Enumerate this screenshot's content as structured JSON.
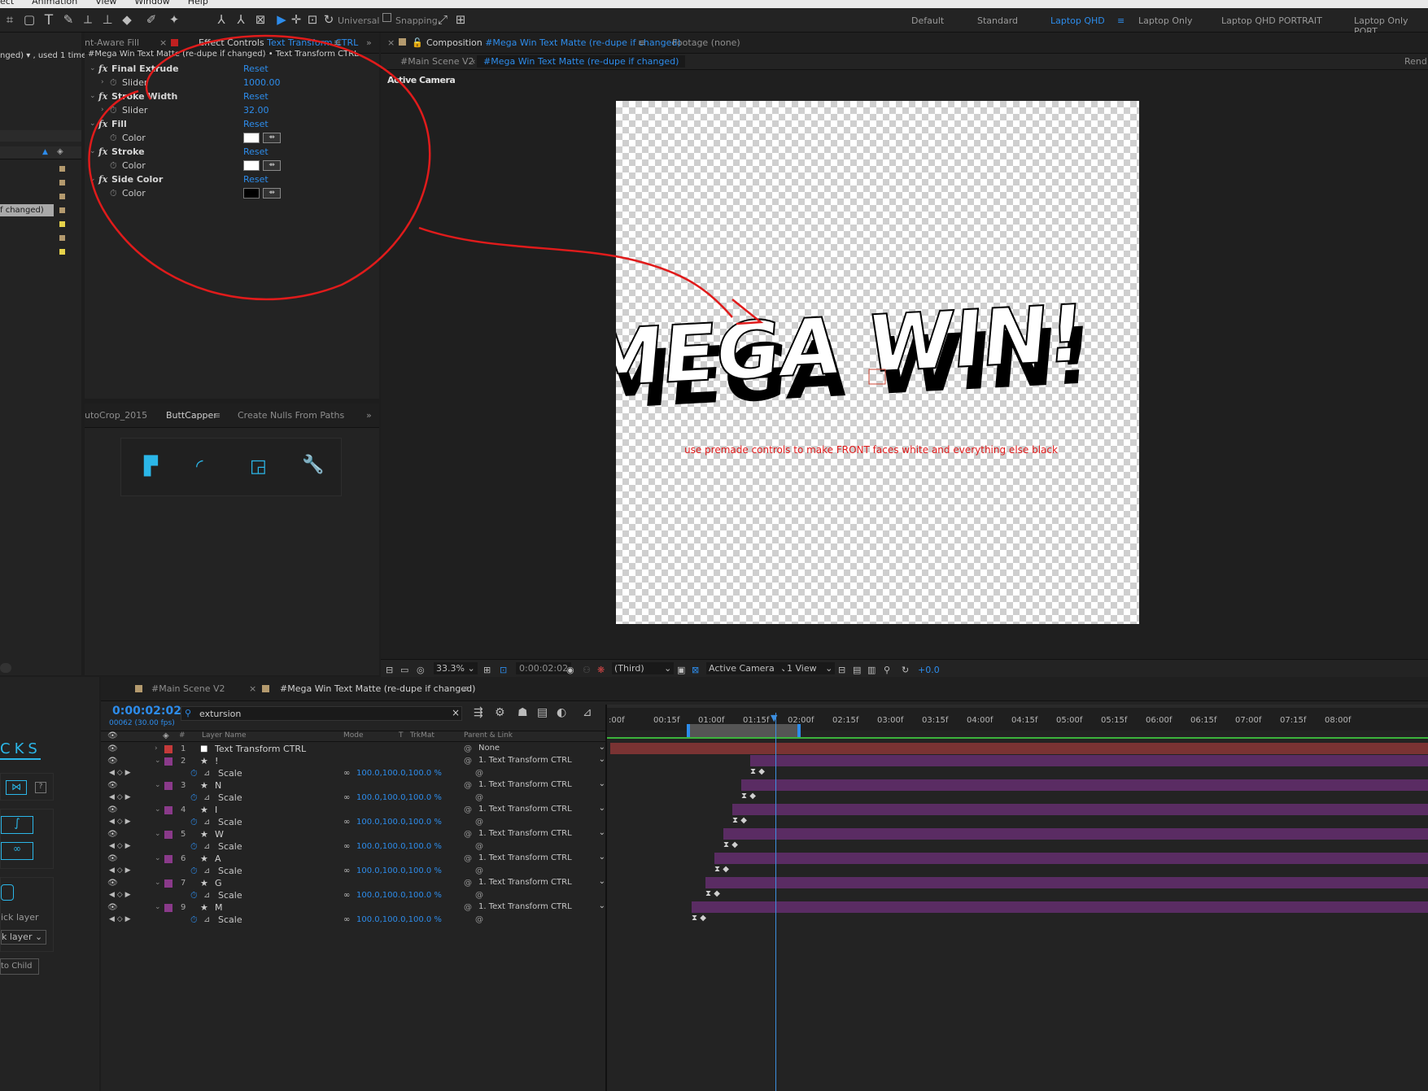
{
  "menu": {
    "items": [
      "ect",
      "Animation",
      "View",
      "Window",
      "Help"
    ]
  },
  "toolbar": {
    "universal_label": "Universal",
    "snapping_label": "Snapping"
  },
  "workspaces": [
    {
      "label": "Default",
      "active": false
    },
    {
      "label": "Standard",
      "active": false
    },
    {
      "label": "Laptop QHD",
      "active": true
    },
    {
      "label": "Laptop Only",
      "active": false
    },
    {
      "label": "Laptop QHD PORTRAIT",
      "active": false
    },
    {
      "label": "Laptop Only PORT",
      "active": false
    }
  ],
  "project": {
    "used_label": "nged) ▾ , used 1 time",
    "selected_item": "f changed)"
  },
  "effect_controls": {
    "tab_prev": "nt-Aware Fill",
    "tab_label": "Effect Controls",
    "tab_target": "Text Transform CTRL",
    "header": "#Mega Win Text Matte (re-dupe if changed) • Text Transform CTRL",
    "rows": [
      {
        "name": "Final Extrude",
        "kind": "effect",
        "value": "Reset"
      },
      {
        "name": "Slider",
        "kind": "prop",
        "value": "1000.00"
      },
      {
        "name": "Stroke Width",
        "kind": "effect",
        "value": "Reset"
      },
      {
        "name": "Slider",
        "kind": "prop",
        "value": "32.00"
      },
      {
        "name": "Fill",
        "kind": "effect",
        "value": "Reset"
      },
      {
        "name": "Color",
        "kind": "color",
        "color": "#ffffff"
      },
      {
        "name": "Stroke",
        "kind": "effect",
        "value": "Reset"
      },
      {
        "name": "Color",
        "kind": "color",
        "color": "#ffffff"
      },
      {
        "name": "Side Color",
        "kind": "effect",
        "value": "Reset"
      },
      {
        "name": "Color",
        "kind": "color",
        "color": "#000000"
      }
    ]
  },
  "lower_left": {
    "tabs": [
      "utoCrop_2015",
      "ButtCapper",
      "Create Nulls From Paths"
    ],
    "active_tab": "ButtCapper"
  },
  "composition": {
    "tab_label": "Composition",
    "tab_name": "#Mega Win Text Matte (re-dupe if changed)",
    "footage_label": "Footage",
    "footage_value": "(none)",
    "breadcrumbs": [
      "#Main Scene V2",
      "#Mega Win Text Matte (re-dupe if changed)"
    ],
    "render_label": "Rend",
    "camera_label": "Active Camera",
    "canvas_text": "MEGA WIN!",
    "annotation": "use premade controls to make FRONT faces white and everything else black",
    "footer": {
      "zoom": "33.3%",
      "timecode": "0:00:02:02",
      "resolution": "(Third)",
      "camera": "Active Camera",
      "views": "1 View",
      "exposure": "+0.0"
    }
  },
  "timeline": {
    "tabs": [
      "#Main Scene V2",
      "#Mega Win Text Matte (re-dupe if changed)"
    ],
    "timecode": "0:00:02:02",
    "frames": "00062 (30.00 fps)",
    "search": "extursion",
    "columns": {
      "layer_name": "Layer Name",
      "mode": "Mode",
      "t": "T",
      "trkmat": "TrkMat",
      "parent": "Parent & Link"
    },
    "ruler": [
      ":00f",
      "00:15f",
      "01:00f",
      "01:15f",
      "02:00f",
      "02:15f",
      "03:00f",
      "03:15f",
      "04:00f",
      "04:15f",
      "05:00f",
      "05:15f",
      "06:00f",
      "06:15f",
      "07:00f",
      "07:15f",
      "08:00f"
    ],
    "layers": [
      {
        "num": "1",
        "name": "Text Transform CTRL",
        "parent": "None",
        "scale": null
      },
      {
        "num": "2",
        "name": "!",
        "parent": "1. Text Transform CTRL",
        "scale": "100.0,100.0,100.0 %"
      },
      {
        "num": "3",
        "name": "N",
        "parent": "1. Text Transform CTRL",
        "scale": "100.0,100.0,100.0 %"
      },
      {
        "num": "4",
        "name": "I",
        "parent": "1. Text Transform CTRL",
        "scale": "100.0,100.0,100.0 %"
      },
      {
        "num": "5",
        "name": "W",
        "parent": "1. Text Transform CTRL",
        "scale": "100.0,100.0,100.0 %"
      },
      {
        "num": "6",
        "name": "A",
        "parent": "1. Text Transform CTRL",
        "scale": "100.0,100.0,100.0 %"
      },
      {
        "num": "7",
        "name": "G",
        "parent": "1. Text Transform CTRL",
        "scale": "100.0,100.0,100.0 %"
      },
      {
        "num": "9",
        "name": "M",
        "parent": "1. Text Transform CTRL",
        "scale": "100.0,100.0,100.0 %"
      }
    ],
    "scale_label": "Scale"
  },
  "left_dock": {
    "title": "CKS",
    "pick_label": "ick layer",
    "pick_select": "k layer",
    "child_btn": "to Child"
  },
  "colors": {
    "accent": "#2d8ceb",
    "annotation": "#e01b1b",
    "layer_purple": "#5a2c63",
    "layer_red": "#7a3333"
  }
}
